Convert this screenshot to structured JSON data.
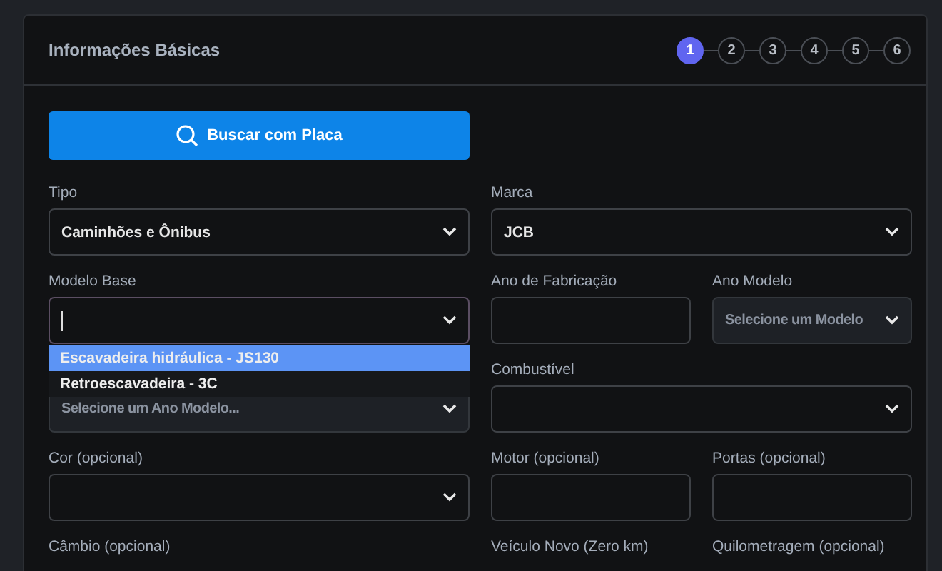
{
  "card": {
    "title": "Informações Básicas",
    "steps": [
      {
        "label": "1",
        "selected": true
      },
      {
        "label": "2",
        "selected": false
      },
      {
        "label": "3",
        "selected": false
      },
      {
        "label": "4",
        "selected": false
      },
      {
        "label": "5",
        "selected": false
      },
      {
        "label": "6",
        "selected": false
      }
    ],
    "search_button": {
      "label": "Buscar com Placa"
    },
    "rows": [
      {
        "fields": [
          {
            "label": "Tipo",
            "kind": "select",
            "value": "Caminhões e Ônibus",
            "disabled": false,
            "focused": false
          },
          {
            "label": "Marca",
            "kind": "select",
            "value": "JCB",
            "disabled": false,
            "focused": false
          }
        ]
      },
      {
        "fields": [
          {
            "label": "Modelo Base",
            "kind": "select",
            "disabled": false,
            "focused": true,
            "options": [
              {
                "label": "Escavadeira hidráulica - JS130",
                "selected": true
              },
              {
                "label": "Retroescavadeira - 3C",
                "selected": false
              }
            ]
          },
          {
            "label": "Ano de Fabricação",
            "kind": "text",
            "disabled": false,
            "focused": false
          },
          {
            "label": "Ano Modelo",
            "kind": "select",
            "placeholder": "Selecione um Modelo",
            "disabled": true,
            "focused": false
          }
        ]
      },
      {
        "fields": [
          {
            "kind": "select",
            "placeholder": "Selecione um Ano Modelo...",
            "disabled": true,
            "focused": false
          },
          {
            "label": "Combustível",
            "kind": "select",
            "disabled": false,
            "focused": false
          }
        ]
      },
      {
        "fields": [
          {
            "label": "Cor (opcional)",
            "kind": "select",
            "disabled": false,
            "focused": false
          },
          {
            "label": "Motor (opcional)",
            "kind": "text",
            "disabled": false,
            "focused": false
          },
          {
            "label": "Portas (opcional)",
            "kind": "text",
            "disabled": false,
            "focused": false
          }
        ]
      },
      {
        "fields": [
          {
            "label": "Câmbio (opcional)",
            "kind": "label"
          },
          {
            "label": "Veículo Novo (Zero km)",
            "kind": "label"
          },
          {
            "label": "Quilometragem (opcional)",
            "kind": "label"
          }
        ]
      }
    ]
  }
}
